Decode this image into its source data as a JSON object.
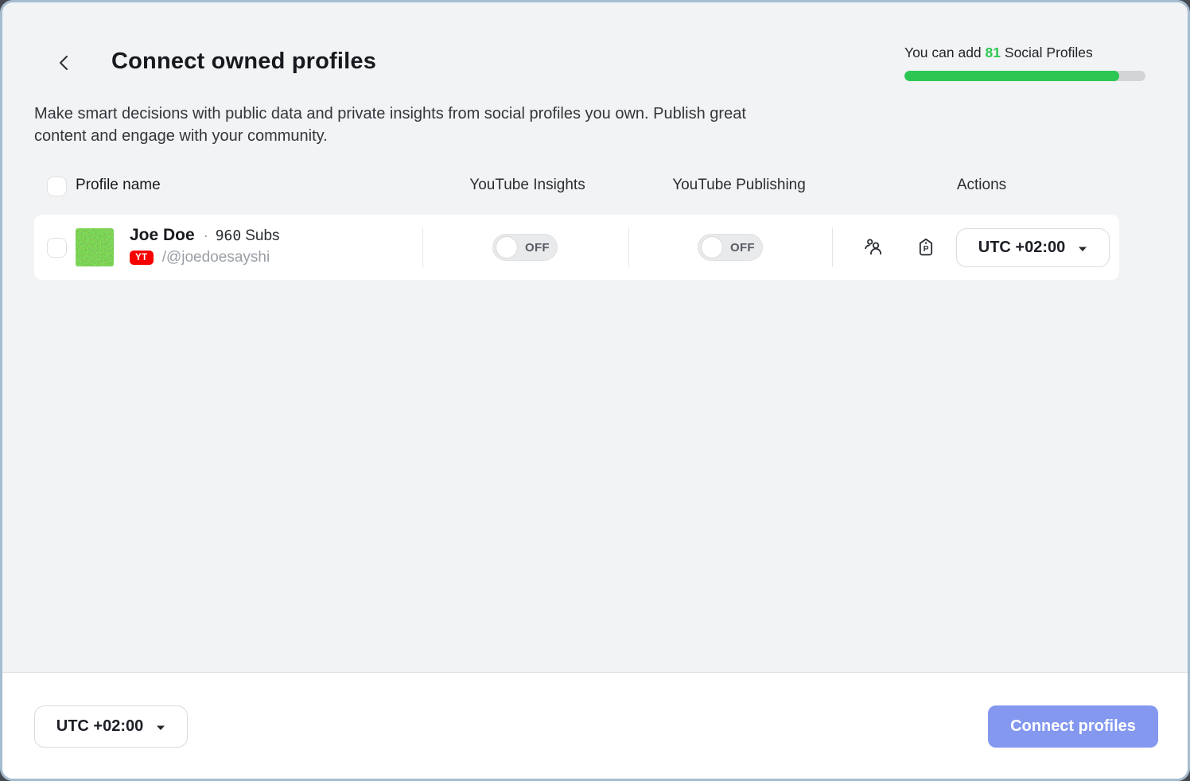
{
  "header": {
    "title": "Connect owned profiles",
    "capacity": {
      "prefix": "You can add",
      "count": "81",
      "suffix": "Social Profiles",
      "progress_percent": 89
    }
  },
  "description": "Make smart decisions with public data and private insights from social profiles you own. Publish great content and engage with your community.",
  "table": {
    "columns": {
      "profile": "Profile name",
      "insights": "YouTube Insights",
      "publishing": "YouTube Publishing",
      "actions": "Actions"
    },
    "rows": [
      {
        "name": "Joe Doe",
        "separator": "·",
        "subs_value": "960",
        "subs_unit": "Subs",
        "network_badge": "YT",
        "handle": "/@joedoesayshi",
        "insights": {
          "state": "off",
          "label": "OFF"
        },
        "publishing": {
          "state": "off",
          "label": "OFF"
        },
        "timezone": "UTC +02:00"
      }
    ]
  },
  "footer": {
    "timezone": "UTC +02:00",
    "connect_label": "Connect profiles"
  },
  "colors": {
    "accent_green": "#2cc653",
    "progress_track": "#d3d4d6",
    "connect_button_blue": "#8498f0",
    "youtube_red": "#f70000",
    "modal_border": "#a6bdd0",
    "background_gray": "#f2f3f4"
  }
}
